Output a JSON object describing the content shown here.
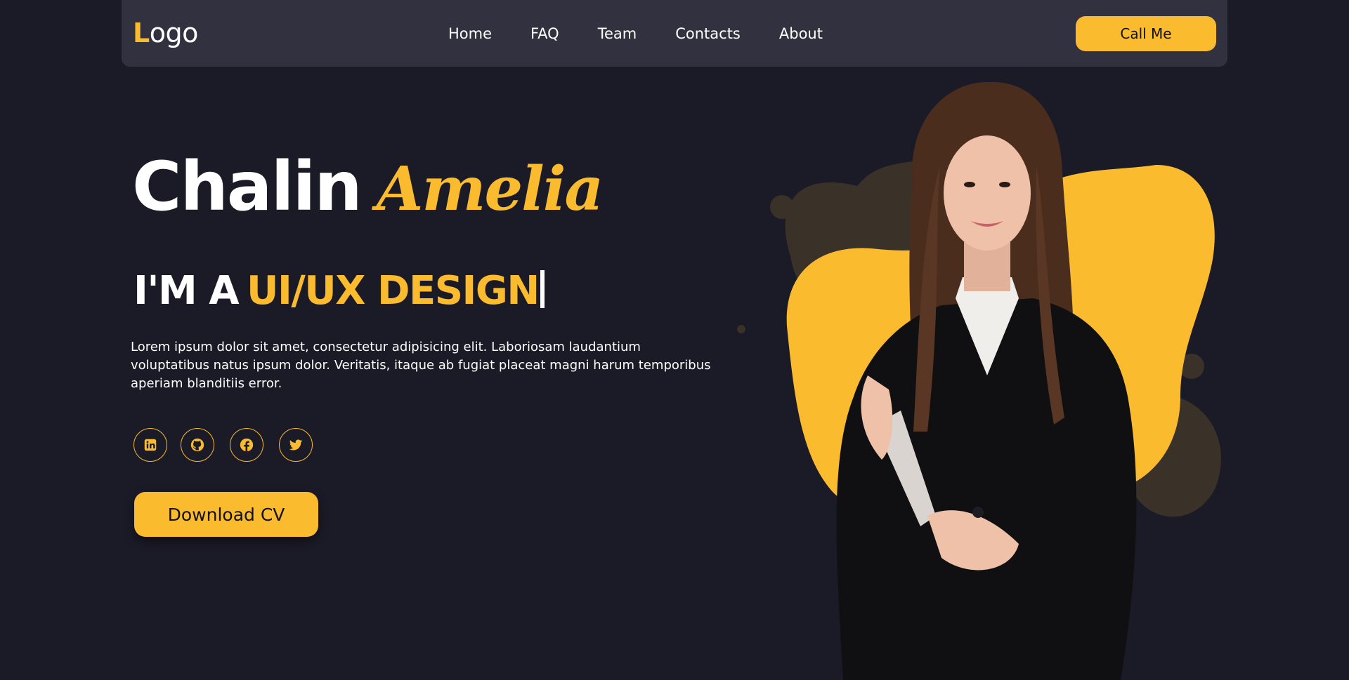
{
  "nav": {
    "logo_first": "L",
    "logo_rest": "ogo",
    "links": [
      "Home",
      "FAQ",
      "Team",
      "Contacts",
      "About"
    ],
    "cta_label": "Call Me"
  },
  "hero": {
    "first_name": "Chalin",
    "last_name": "Amelia",
    "role_prefix": "I'M A",
    "role_highlight": "UI/UX DESIGN",
    "description": "Lorem ipsum dolor sit amet, consectetur adipisicing elit. Laboriosam laudantium voluptatibus natus ipsum dolor. Veritatis, itaque ab fugiat placeat magni harum temporibus aperiam blanditiis error.",
    "download_label": "Download CV"
  },
  "socials": [
    {
      "icon": "linkedin-icon"
    },
    {
      "icon": "github-icon"
    },
    {
      "icon": "facebook-icon"
    },
    {
      "icon": "twitter-icon"
    }
  ],
  "colors": {
    "accent": "#fbbb2e",
    "background": "#1b1a27",
    "navbar": "#323140",
    "blob_dark": "#3a3228"
  }
}
